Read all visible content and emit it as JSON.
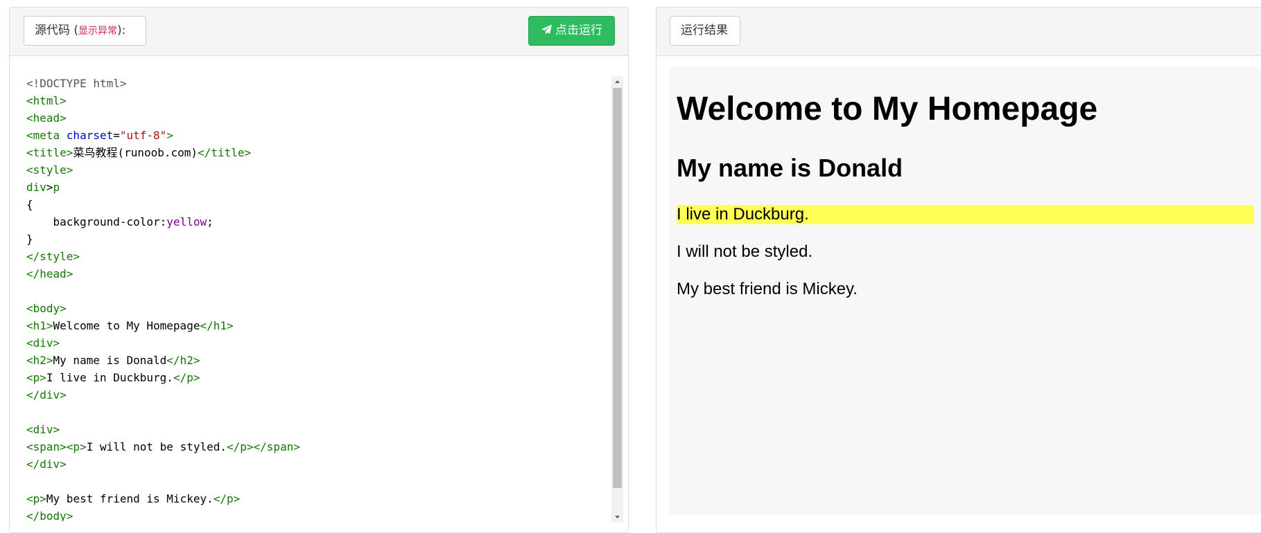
{
  "source_panel": {
    "label_main": "源代码 (",
    "label_error": "显示异常",
    "label_tail": "):",
    "run_button": "点击运行",
    "run_icon": "paper-plane-icon"
  },
  "result_panel": {
    "label": "运行结果"
  },
  "code_lines": [
    [
      {
        "t": "<!DOCTYPE html>",
        "c": "doc"
      }
    ],
    [
      {
        "t": "<html>",
        "c": "tag"
      }
    ],
    [
      {
        "t": "<head>",
        "c": "tag"
      }
    ],
    [
      {
        "t": "<meta ",
        "c": "tag"
      },
      {
        "t": "charset",
        "c": "attr"
      },
      {
        "t": "=",
        "c": ""
      },
      {
        "t": "\"utf-8\"",
        "c": "str"
      },
      {
        "t": ">",
        "c": "tag"
      }
    ],
    [
      {
        "t": "<title>",
        "c": "tag"
      },
      {
        "t": "菜鸟教程(runoob.com)",
        "c": ""
      },
      {
        "t": "</title>",
        "c": "tag"
      }
    ],
    [
      {
        "t": "<style>",
        "c": "tag"
      }
    ],
    [
      {
        "t": "div",
        "c": "kw"
      },
      {
        "t": ">",
        "c": ""
      },
      {
        "t": "p",
        "c": "kw"
      }
    ],
    [
      {
        "t": "{",
        "c": ""
      }
    ],
    [
      {
        "t": "    background-color:",
        "c": ""
      },
      {
        "t": "yellow",
        "c": "val"
      },
      {
        "t": ";",
        "c": ""
      }
    ],
    [
      {
        "t": "}",
        "c": ""
      }
    ],
    [
      {
        "t": "</style>",
        "c": "tag"
      }
    ],
    [
      {
        "t": "</head>",
        "c": "tag"
      }
    ],
    [],
    [
      {
        "t": "<body>",
        "c": "tag"
      }
    ],
    [
      {
        "t": "<h1>",
        "c": "tag"
      },
      {
        "t": "Welcome to My Homepage",
        "c": ""
      },
      {
        "t": "</h1>",
        "c": "tag"
      }
    ],
    [
      {
        "t": "<div>",
        "c": "tag"
      }
    ],
    [
      {
        "t": "<h2>",
        "c": "tag"
      },
      {
        "t": "My name is Donald",
        "c": ""
      },
      {
        "t": "</h2>",
        "c": "tag"
      }
    ],
    [
      {
        "t": "<p>",
        "c": "tag"
      },
      {
        "t": "I live in Duckburg.",
        "c": ""
      },
      {
        "t": "</p>",
        "c": "tag"
      }
    ],
    [
      {
        "t": "</div>",
        "c": "tag"
      }
    ],
    [],
    [
      {
        "t": "<div>",
        "c": "tag"
      }
    ],
    [
      {
        "t": "<span><p>",
        "c": "tag"
      },
      {
        "t": "I will not be styled.",
        "c": ""
      },
      {
        "t": "</p></span>",
        "c": "tag"
      }
    ],
    [
      {
        "t": "</div>",
        "c": "tag"
      }
    ],
    [],
    [
      {
        "t": "<p>",
        "c": "tag"
      },
      {
        "t": "My best friend is Mickey.",
        "c": ""
      },
      {
        "t": "</p>",
        "c": "tag"
      }
    ],
    [
      {
        "t": "</body>",
        "c": "tag"
      }
    ]
  ],
  "result": {
    "h1": "Welcome to My Homepage",
    "h2": "My name is Donald",
    "p_styled": "I live in Duckburg.",
    "p_unstyled": "I will not be styled.",
    "p_last": "My best friend is Mickey."
  },
  "colors": {
    "run_button": "#2fbb5f",
    "highlight": "#ffff55",
    "error_text": "#c7254e"
  }
}
